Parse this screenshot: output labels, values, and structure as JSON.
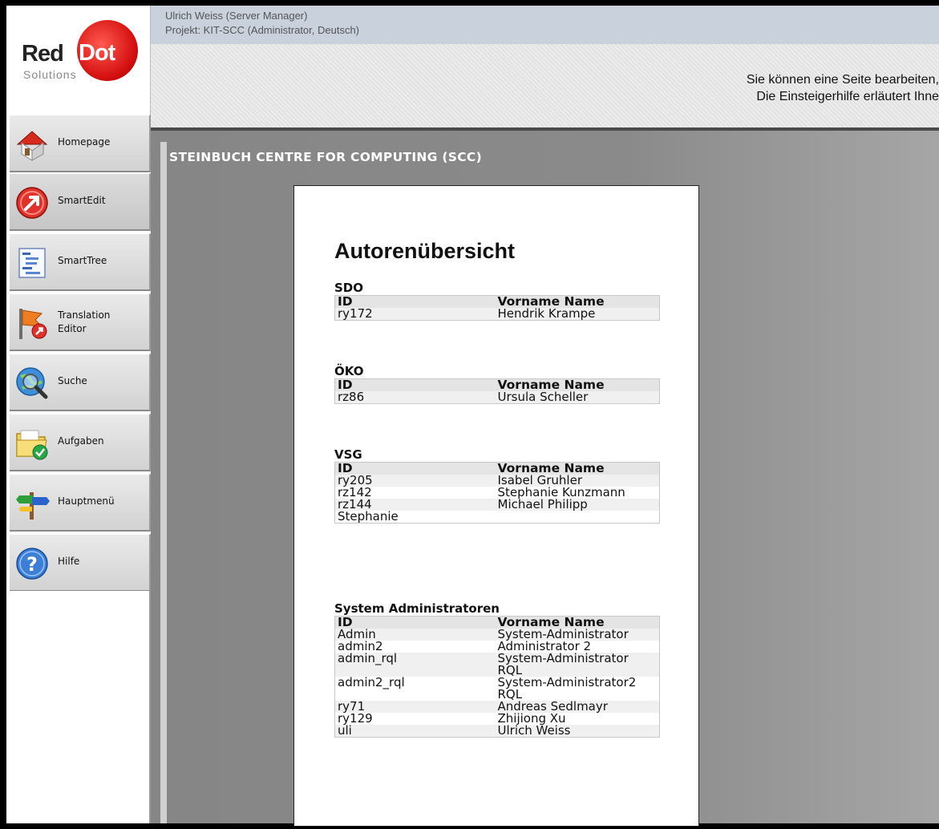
{
  "logo": {
    "word1": "Red",
    "word2": "Dot",
    "sub": "Solutions"
  },
  "header": {
    "user_line": "Ulrich Weiss (Server Manager)",
    "project_line": "Projekt: KIT-SCC (Administrator, Deutsch)",
    "message_line1": "Sie können eine Seite bearbeiten,",
    "message_line2": "Die Einsteigerhilfe erläutert Ihne"
  },
  "nav": [
    {
      "label": "Homepage",
      "icon": "house-icon"
    },
    {
      "label": "SmartEdit",
      "icon": "edit-arrow-icon"
    },
    {
      "label": "SmartTree",
      "icon": "tree-list-icon"
    },
    {
      "label": "Translation Editor",
      "line1": "Translation",
      "line2": "Editor",
      "icon": "flag-icon"
    },
    {
      "label": "Suche",
      "icon": "search-globe-icon"
    },
    {
      "label": "Aufgaben",
      "icon": "folder-check-icon"
    },
    {
      "label": "Hauptmenü",
      "icon": "signpost-icon"
    },
    {
      "label": "Hilfe",
      "icon": "help-icon"
    }
  ],
  "site_title": "STEINBUCH CENTRE FOR COMPUTING (SCC)",
  "page": {
    "heading": "Autorenübersicht",
    "col_id": "ID",
    "col_name": "Vorname Name",
    "groups": [
      {
        "name": "SDO",
        "rows": [
          [
            "ry172",
            "Hendrik Krampe"
          ]
        ]
      },
      {
        "name": "ÖKO",
        "rows": [
          [
            "rz86",
            "Ursula Scheller"
          ]
        ]
      },
      {
        "name": "VSG",
        "rows": [
          [
            "ry205",
            "Isabel Gruhler"
          ],
          [
            "rz142",
            "Stephanie Kunzmann"
          ],
          [
            "rz144",
            "Michael Philipp"
          ],
          [
            "Stephanie",
            ""
          ]
        ]
      },
      {
        "name": "System Administratoren",
        "rows": [
          [
            "Admin",
            "System-Administrator"
          ],
          [
            "admin2",
            "Administrator 2"
          ],
          [
            "admin_rql",
            "System-Administrator RQL"
          ],
          [
            "admin2_rql",
            "System-Administrator2 RQL"
          ],
          [
            "ry71",
            "Andreas Sedlmayr"
          ],
          [
            "ry129",
            "Zhijiong Xu"
          ],
          [
            "uli",
            "Ulrich Weiss"
          ]
        ]
      }
    ]
  }
}
